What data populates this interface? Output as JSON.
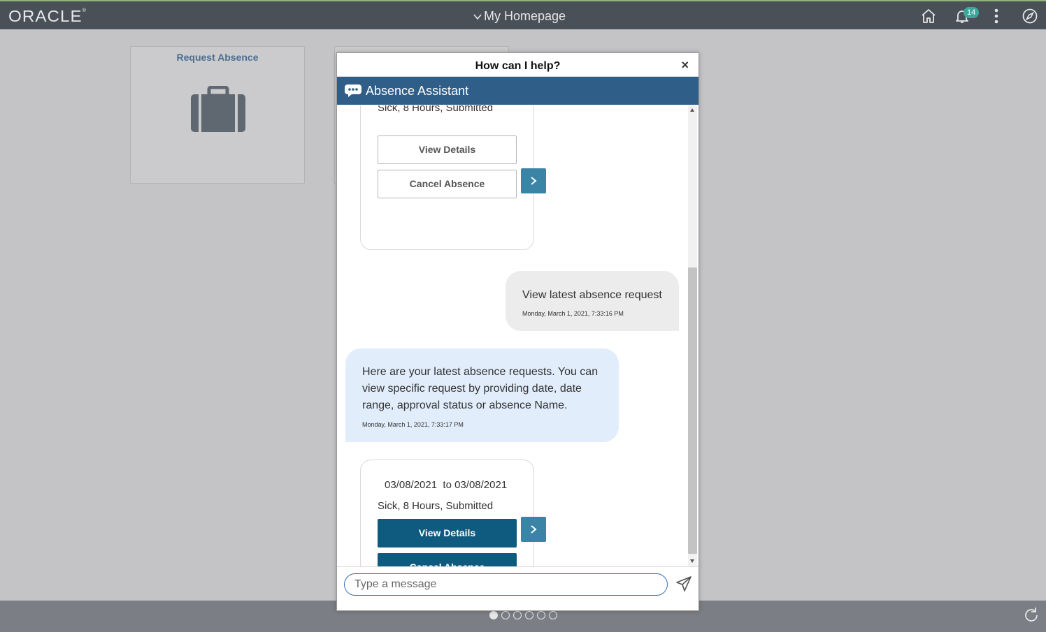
{
  "header": {
    "logo": "ORACLE",
    "page_title": "My Homepage",
    "notification_count": "14"
  },
  "tiles": [
    {
      "title": "Request Absence",
      "icon": "briefcase-icon"
    }
  ],
  "dialog": {
    "title": "How can I help?",
    "close": "×",
    "assistant_name": "Absence Assistant",
    "messages": {
      "top_card": {
        "partial_line": "Sick, 8 Hours, Submitted",
        "view_details": "View Details",
        "cancel_absence": "Cancel Absence"
      },
      "user_msg": {
        "text": "View latest absence request",
        "time": "Monday, March 1, 2021, 7:33:16 PM"
      },
      "bot_msg": {
        "text": "Here are your latest absence requests. You can view specific request by providing date, date range, approval status or absence Name.",
        "time": "Monday, March 1, 2021, 7:33:17 PM"
      },
      "bottom_card": {
        "date_range": "03/08/2021  to 03/08/2021",
        "details": "Sick, 8 Hours, Submitted",
        "view_details": "View Details",
        "cancel_absence": "Cancel Absence"
      }
    },
    "input": {
      "placeholder": "Type a message",
      "value": ""
    }
  },
  "footer": {
    "page_dots": 6,
    "active_dot": 0
  },
  "colors": {
    "header_bg": "#4a5058",
    "assistant_bar": "#2f5e89",
    "primary_button": "#0e5b7f",
    "next_button": "#3a84a6",
    "bot_bubble": "#e1edfb",
    "user_bubble": "#ececec",
    "badge": "#3aa99b"
  }
}
